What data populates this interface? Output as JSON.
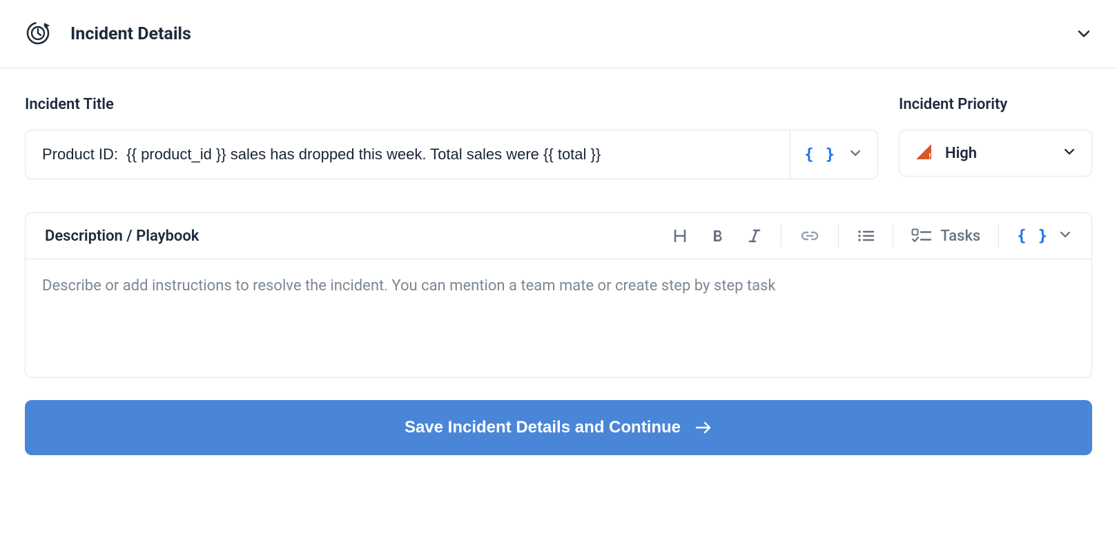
{
  "header": {
    "title": "Incident Details"
  },
  "form": {
    "title_label": "Incident Title",
    "title_value": "Product ID:  {{ product_id }} sales has dropped this week. Total sales were {{ total }}",
    "priority_label": "Incident Priority",
    "priority_value": "High"
  },
  "editor": {
    "label": "Description / Playbook",
    "tasks_label": "Tasks",
    "placeholder": "Describe or add instructions to resolve the incident. You can mention a team mate or create step by step task"
  },
  "actions": {
    "save_label": "Save Incident Details and Continue"
  }
}
